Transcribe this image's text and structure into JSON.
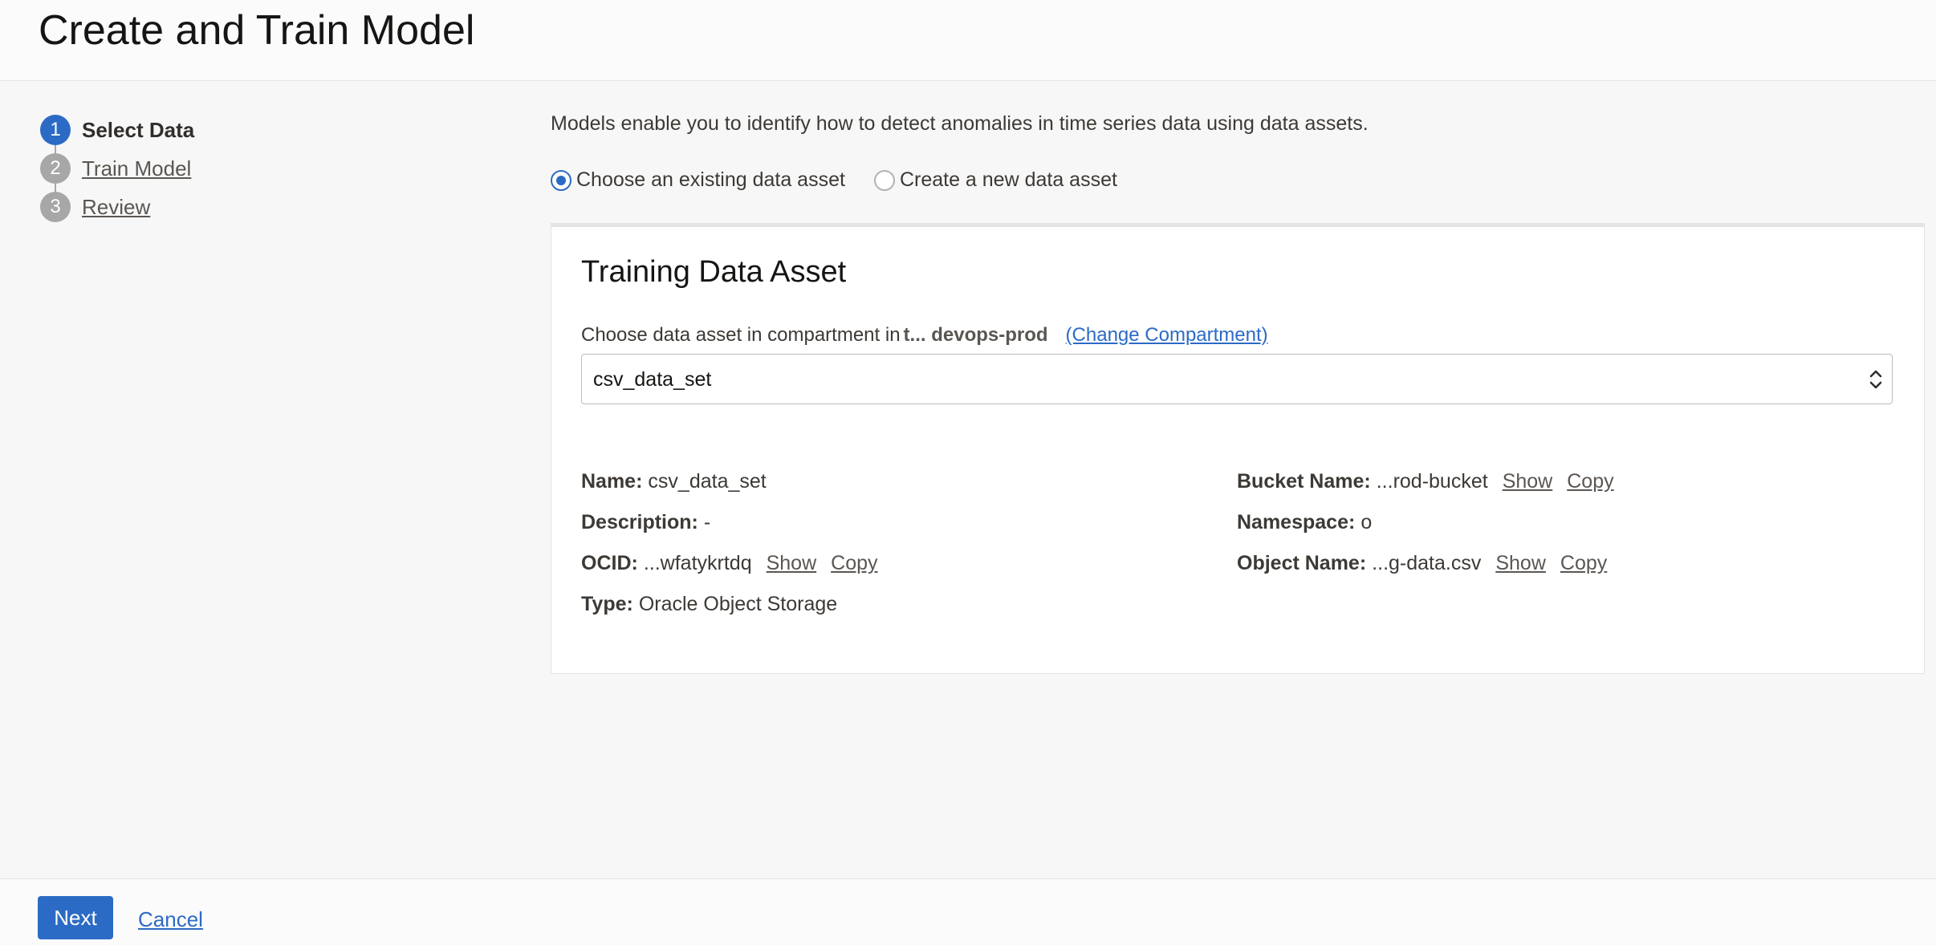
{
  "header": {
    "title": "Create and Train Model"
  },
  "steps": [
    {
      "number": "1",
      "label": "Select Data",
      "state": "active"
    },
    {
      "number": "2",
      "label": "Train Model",
      "state": "link"
    },
    {
      "number": "3",
      "label": "Review",
      "state": "link"
    }
  ],
  "main": {
    "intro": "Models enable you to identify how to detect anomalies in time series data using data assets.",
    "radios": [
      {
        "label": "Choose an existing data asset",
        "checked": true
      },
      {
        "label": "Create a new data asset",
        "checked": false
      }
    ]
  },
  "card": {
    "title": "Training Data Asset",
    "compartment_prefix": "Choose data asset in compartment in",
    "compartment_name": "t... devops-prod",
    "change_link": "(Change Compartment)",
    "select_value": "csv_data_set",
    "details_left": [
      {
        "key": "Name:",
        "value": "csv_data_set"
      },
      {
        "key": "Description:",
        "value": "-"
      },
      {
        "key": "OCID:",
        "value": "...wfatykrtdq",
        "show": "Show",
        "copy": "Copy"
      },
      {
        "key": "Type:",
        "value": "Oracle Object Storage"
      }
    ],
    "details_right": [
      {
        "key": "Bucket Name:",
        "value": "...rod-bucket",
        "show": "Show",
        "copy": "Copy"
      },
      {
        "key": "Namespace:",
        "value": "o"
      },
      {
        "key": "Object Name:",
        "value": "...g-data.csv",
        "show": "Show",
        "copy": "Copy"
      }
    ]
  },
  "footer": {
    "next": "Next",
    "cancel": "Cancel"
  },
  "colors": {
    "accent": "#2c6bc5",
    "inactive_step": "#a7a7a7"
  }
}
